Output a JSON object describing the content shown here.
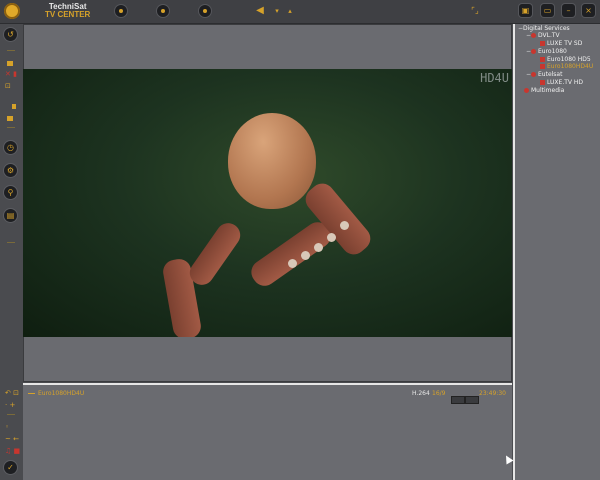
{
  "brand": {
    "line1": "TechniSat",
    "line2": "TV CENTER"
  },
  "toolbar": {
    "icons": [
      "logo-icon",
      "record-icon",
      "pause-icon",
      "play-icon",
      "speaker-icon",
      "volume-down-icon",
      "volume-up-icon",
      "fullscreen-icon",
      "screenshot-icon",
      "window-icon",
      "minimize-icon",
      "close-icon"
    ]
  },
  "video": {
    "watermark": "HD4U"
  },
  "infobar": {
    "channel": "Euro1080HD4U",
    "codec": "H.264",
    "aspect": "16/9",
    "time": "23:49:30"
  },
  "tree": {
    "root": "Digital Services",
    "groups": [
      {
        "label": "DVL.TV",
        "channels": [
          "LUXE TV SD"
        ]
      },
      {
        "label": "Euro1080",
        "channels": [
          "Euro1080 HD5",
          "Euro1080HD4U"
        ]
      },
      {
        "label": "Eutelsat",
        "channels": [
          "LUXE.TV HD"
        ]
      }
    ],
    "multimedia": "Multimedia",
    "selected": "Euro1080HD4U"
  },
  "colors": {
    "accent": "#d6a22a",
    "background": "#4a4b4f",
    "panel": "#6a6b70",
    "red": "#c8362e"
  }
}
